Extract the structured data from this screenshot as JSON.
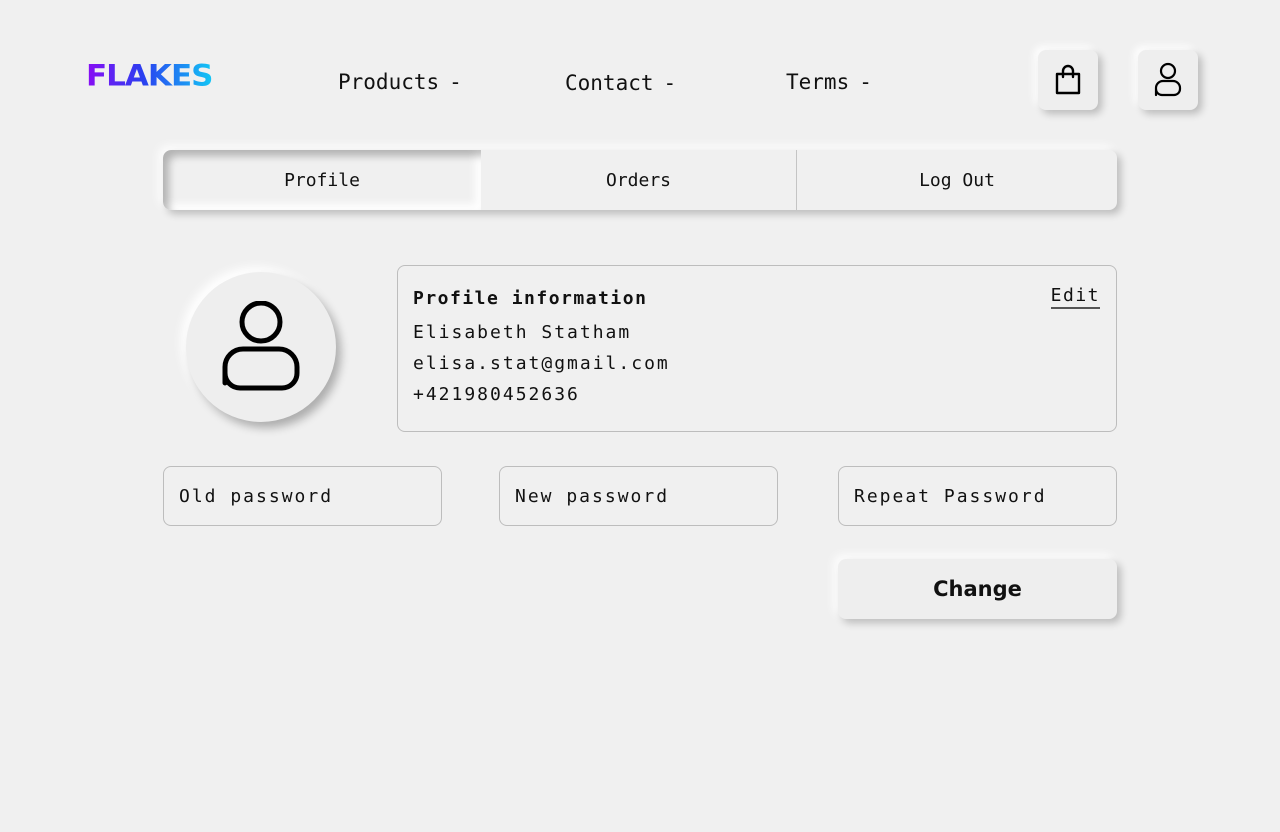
{
  "brand": {
    "logo_text": "FLAKES"
  },
  "nav": {
    "items": [
      {
        "label": "Products",
        "suffix": "-"
      },
      {
        "label": "Contact",
        "suffix": "-"
      },
      {
        "label": "Terms",
        "suffix": "-"
      }
    ],
    "icons": [
      "shopping-bag-icon",
      "user-icon"
    ]
  },
  "tabs": [
    {
      "label": "Profile",
      "active": true
    },
    {
      "label": "Orders",
      "active": false
    },
    {
      "label": "Log Out",
      "active": false
    }
  ],
  "profile": {
    "avatar_icon": "user-icon",
    "title": "Profile information",
    "edit_label": "Edit",
    "name": "Elisabeth Statham",
    "email": "elisa.stat@gmail.com",
    "phone": "+421980452636"
  },
  "password": {
    "old_placeholder": "Old password",
    "new_placeholder": "New password",
    "repeat_placeholder": "Repeat Password",
    "change_label": "Change"
  },
  "colors": {
    "background": "#f0f0f0",
    "logo_gradient": [
      "#8a0cf5",
      "#2a3ff0",
      "#13c6f5"
    ],
    "border": "#bdbdbd"
  }
}
